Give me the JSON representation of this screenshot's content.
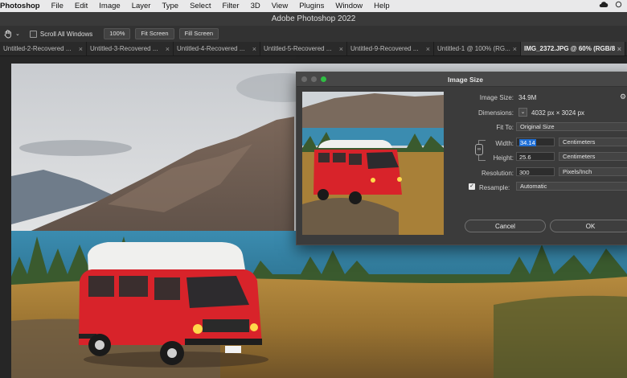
{
  "menubar": {
    "app_name": "Photoshop",
    "items": [
      "File",
      "Edit",
      "Image",
      "Layer",
      "Type",
      "Select",
      "Filter",
      "3D",
      "View",
      "Plugins",
      "Window",
      "Help"
    ]
  },
  "window": {
    "title": "Adobe Photoshop 2022"
  },
  "options_bar": {
    "scroll_all_label": "Scroll All Windows",
    "zoom_label": "100%",
    "fit_screen_label": "Fit Screen",
    "fill_screen_label": "Fill Screen"
  },
  "tabs": [
    {
      "label": "Untitled-2-Recovered ...",
      "close": "×"
    },
    {
      "label": "Untitled-3-Recovered ...",
      "close": "×"
    },
    {
      "label": "Untitled-4-Recovered ...",
      "close": "×"
    },
    {
      "label": "Untitled-5-Recovered ...",
      "close": "×"
    },
    {
      "label": "Untitled-9-Recovered ...",
      "close": "×"
    },
    {
      "label": "Untitled-1 @ 100% (RG...",
      "close": "×"
    },
    {
      "label": "IMG_2372.JPG @ 60% (RGB/8",
      "close": "×"
    }
  ],
  "dialog": {
    "title": "Image Size",
    "image_size_label": "Image Size:",
    "image_size_value": "34.9M",
    "dimensions_label": "Dimensions:",
    "dimensions_value": "4032 px  ×  3024 px",
    "fit_to_label": "Fit To:",
    "fit_to_value": "Original Size",
    "width_label": "Width:",
    "width_value": "34.14",
    "width_unit": "Centimeters",
    "height_label": "Height:",
    "height_value": "25.6",
    "height_unit": "Centimeters",
    "resolution_label": "Resolution:",
    "resolution_value": "300",
    "resolution_unit": "Pixels/Inch",
    "resample_label": "Resample:",
    "resample_value": "Automatic",
    "cancel_label": "Cancel",
    "ok_label": "OK"
  },
  "colors": {
    "accent": "#1f6fd6",
    "van_red": "#d8232a",
    "lake": "#3f8fb0"
  }
}
